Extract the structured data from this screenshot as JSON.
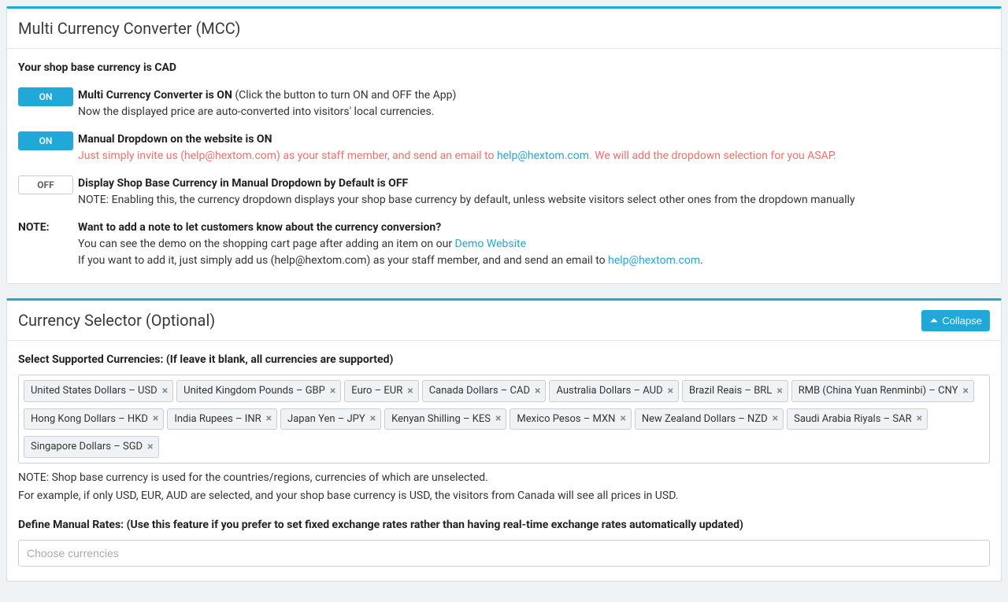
{
  "panel1": {
    "title": "Multi Currency Converter (MCC)",
    "base_line": "Your shop base currency is CAD",
    "row1": {
      "toggle": "ON",
      "head": "Multi Currency Converter is ON",
      "head_note": "(Click the button to turn ON and OFF the App)",
      "desc": "Now the displayed price are auto-converted into visitors' local currencies."
    },
    "row2": {
      "toggle": "ON",
      "head": "Manual Dropdown on the website is ON",
      "desc_pre": "Just simply invite us (help@hextom.com) as your staff member, and send an email to ",
      "desc_link": "help@hextom.com",
      "desc_post": ". We will add the dropdown selection for you ASAP."
    },
    "row3": {
      "toggle": "OFF",
      "head": "Display Shop Base Currency in Manual Dropdown by Default is OFF",
      "desc": "NOTE: Enabling this, the currency dropdown displays your shop base currency by default, unless website visitors select other ones from the dropdown manually"
    },
    "note": {
      "label": "NOTE:",
      "q": "Want to add a note to let customers know about the currency conversion?",
      "line1_pre": "You can see the demo on the shopping cart page after adding an item on our ",
      "line1_link": "Demo Website",
      "line2_pre": "If you want to add it, just simply add us (help@hextom.com) as your staff member, and and send an email to ",
      "line2_link": "help@hextom.com",
      "line2_post": "."
    }
  },
  "panel2": {
    "title": "Currency Selector (Optional)",
    "collapse": "Collapse",
    "select_label": "Select Supported Currencies: (If leave it blank, all currencies are supported)",
    "tags": [
      "United States Dollars – USD",
      "United Kingdom Pounds – GBP",
      "Euro – EUR",
      "Canada Dollars – CAD",
      "Australia Dollars – AUD",
      "Brazil Reais – BRL",
      "RMB (China Yuan Renminbi) – CNY",
      "Hong Kong Dollars – HKD",
      "India Rupees – INR",
      "Japan Yen – JPY",
      "Kenyan Shilling – KES",
      "Mexico Pesos – MXN",
      "New Zealand Dollars – NZD",
      "Saudi Arabia Riyals – SAR",
      "Singapore Dollars – SGD"
    ],
    "note1": "NOTE: Shop base currency is used for the countries/regions, currencies of which are unselected.",
    "note2": "For example, if only USD, EUR, AUD are selected, and your shop base currency is USD, the visitors from Canada will see all prices in USD.",
    "rates_label": "Define Manual Rates: (Use this feature if you prefer to set fixed exchange rates rather than having real-time exchange rates automatically updated)",
    "rates_placeholder": "Choose currencies"
  }
}
